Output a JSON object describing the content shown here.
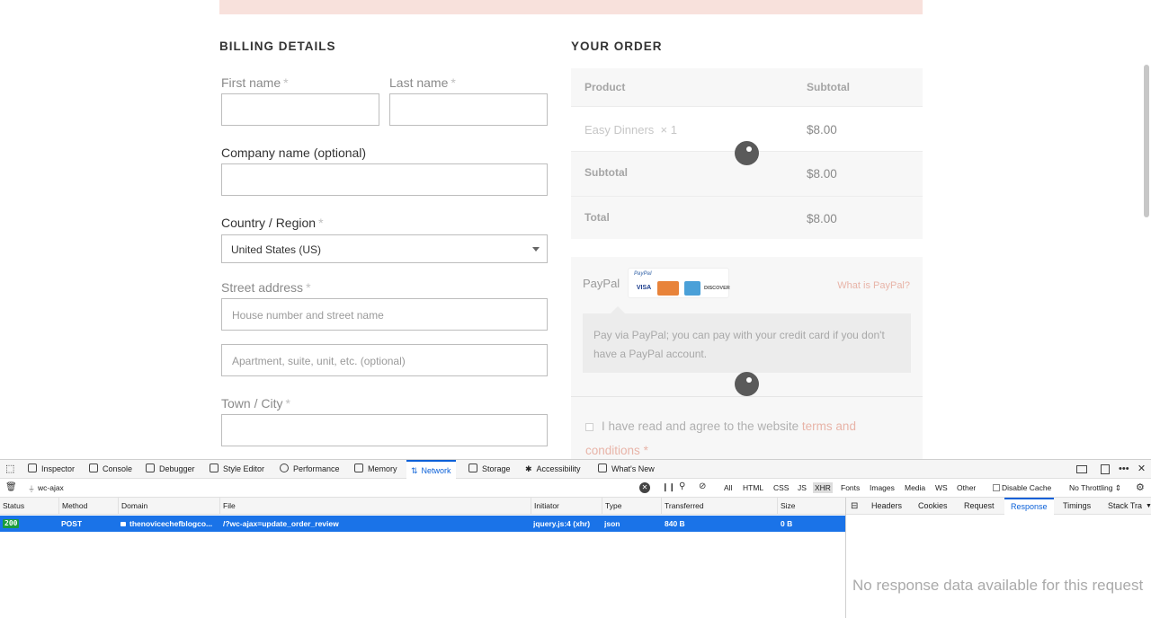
{
  "billing": {
    "title": "BILLING DETAILS",
    "first_name_label": "First name",
    "last_name_label": "Last name",
    "company_label": "Company name (optional)",
    "country_label": "Country / Region",
    "country_value": "United States (US)",
    "street_label": "Street address",
    "street_placeholder_1": "House number and street name",
    "street_placeholder_2": "Apartment, suite, unit, etc. (optional)",
    "city_label": "Town / City",
    "required_mark": "*"
  },
  "order": {
    "title": "YOUR ORDER",
    "col_product": "Product",
    "col_subtotal": "Subtotal",
    "item_name": "Easy Dinners",
    "item_qty": "× 1",
    "item_price": "$8.00",
    "subtotal_label": "Subtotal",
    "subtotal_value": "$8.00",
    "total_label": "Total",
    "total_value": "$8.00"
  },
  "payment": {
    "method_label": "PayPal",
    "logo_text": "PayPal",
    "card_visa": "VISA",
    "card_discover": "DISCOVER",
    "what_is_link": "What is PayPal?",
    "description": "Pay via PayPal; you can pay with your credit card if you don't have a PayPal account.",
    "terms_text": "I have read and agree to the website",
    "terms_link": "terms and conditions",
    "terms_required": "*"
  },
  "devtools": {
    "tabs": {
      "inspector": "Inspector",
      "console": "Console",
      "debugger": "Debugger",
      "style_editor": "Style Editor",
      "performance": "Performance",
      "memory": "Memory",
      "network": "Network",
      "storage": "Storage",
      "accessibility": "Accessibility",
      "whats_new": "What's New"
    },
    "filter_value": "wc-ajax",
    "types": {
      "all": "All",
      "html": "HTML",
      "css": "CSS",
      "js": "JS",
      "xhr": "XHR",
      "fonts": "Fonts",
      "images": "Images",
      "media": "Media",
      "ws": "WS",
      "other": "Other"
    },
    "disable_cache": "Disable Cache",
    "throttling": "No Throttling ⇕",
    "columns": {
      "status": "Status",
      "method": "Method",
      "domain": "Domain",
      "file": "File",
      "initiator": "Initiator",
      "type": "Type",
      "transferred": "Transferred",
      "size": "Size"
    },
    "request": {
      "status": "200",
      "method": "POST",
      "domain": "thenovicechefblogco...",
      "file": "/?wc-ajax=update_order_review",
      "initiator": "jquery.js:4 (xhr)",
      "type": "json",
      "transferred": "840 B",
      "size": "0 B"
    },
    "side_tabs": {
      "headers": "Headers",
      "cookies": "Cookies",
      "request": "Request",
      "response": "Response",
      "timings": "Timings",
      "stack_trace": "Stack Tra"
    },
    "no_response": "No response data available for this request"
  },
  "colors": {
    "accent_blue": "#0a60d8",
    "selected_row": "#1a73e8",
    "status_ok": "#1a9c3b",
    "link_pink": "#e8b4a8"
  }
}
